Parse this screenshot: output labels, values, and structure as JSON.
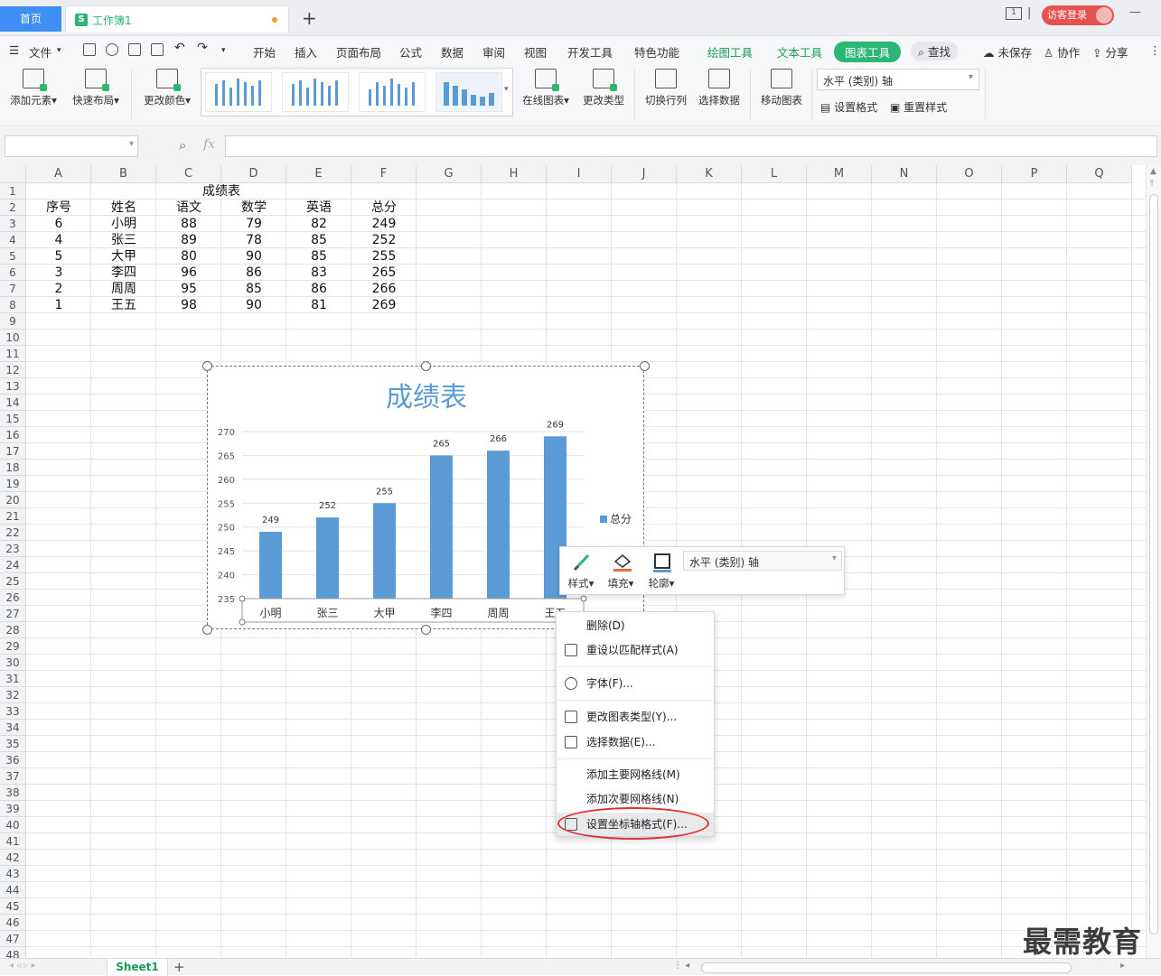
{
  "tabs": {
    "home": "首页",
    "workbook": "工作簿1",
    "new": "+"
  },
  "login": "访客登录",
  "menu": {
    "file": "文件",
    "items": [
      "开始",
      "插入",
      "页面布局",
      "公式",
      "数据",
      "审阅",
      "视图",
      "开发工具",
      "特色功能"
    ],
    "tools": [
      "绘图工具",
      "文本工具"
    ],
    "active": "图表工具",
    "search": "查找",
    "unsaved": "未保存",
    "collab": "协作",
    "share": "分享"
  },
  "ribbon": {
    "add_element": "添加元素",
    "quick_layout": "快速布局",
    "change_color": "更改颜色",
    "online_chart": "在线图表",
    "change_type": "更改类型",
    "switch_row_col": "切换行列",
    "select_data": "选择数据",
    "move_chart": "移动图表",
    "axis_select": "水平 (类别) 轴",
    "set_format": "设置格式",
    "reset_style": "重置样式"
  },
  "formula": {
    "fx": "fx",
    "namebox": "",
    "value": ""
  },
  "columns": [
    "A",
    "B",
    "C",
    "D",
    "E",
    "F",
    "G",
    "H",
    "I",
    "J",
    "K",
    "L",
    "M",
    "N",
    "O",
    "P",
    "Q"
  ],
  "rows": [
    "1",
    "2",
    "3",
    "4",
    "5",
    "6",
    "7",
    "8",
    "9",
    "10",
    "11",
    "12",
    "13",
    "14",
    "15",
    "16",
    "17",
    "18",
    "19",
    "20",
    "21",
    "22",
    "23",
    "24",
    "25",
    "26",
    "27",
    "28",
    "29",
    "30",
    "31",
    "32",
    "33",
    "34",
    "35",
    "36",
    "37",
    "38",
    "39",
    "40",
    "41",
    "42",
    "43",
    "44",
    "45",
    "46",
    "47",
    "48"
  ],
  "sheet": {
    "title": "成绩表",
    "headers": [
      "序号",
      "姓名",
      "语文",
      "数学",
      "英语",
      "总分"
    ],
    "data": [
      [
        "6",
        "小明",
        "88",
        "79",
        "82",
        "249"
      ],
      [
        "4",
        "张三",
        "89",
        "78",
        "85",
        "252"
      ],
      [
        "5",
        "大甲",
        "80",
        "90",
        "85",
        "255"
      ],
      [
        "3",
        "李四",
        "96",
        "86",
        "83",
        "265"
      ],
      [
        "2",
        "周周",
        "95",
        "85",
        "86",
        "266"
      ],
      [
        "1",
        "王五",
        "98",
        "90",
        "81",
        "269"
      ]
    ]
  },
  "chart_data": {
    "type": "bar",
    "title": "成绩表",
    "categories": [
      "小明",
      "张三",
      "大甲",
      "李四",
      "周周",
      "王五"
    ],
    "series": [
      {
        "name": "总分",
        "values": [
          249,
          252,
          255,
          265,
          266,
          269
        ],
        "color": "#5b9bd5"
      }
    ],
    "ylim": [
      235,
      270
    ],
    "yticks": [
      "235",
      "240",
      "245",
      "250",
      "255",
      "260",
      "265",
      "270"
    ],
    "data_labels": true,
    "legend": "right",
    "grid": true
  },
  "float_toolbar": {
    "style": "样式",
    "fill": "填充",
    "outline": "轮廓",
    "axis": "水平 (类别) 轴"
  },
  "context_menu": {
    "delete": "删除(D)",
    "reset_match": "重设以匹配样式(A)",
    "font": "字体(F)...",
    "change_chart_type": "更改图表类型(Y)...",
    "select_data": "选择数据(E)...",
    "add_major_grid": "添加主要网格线(M)",
    "add_minor_grid": "添加次要网格线(N)",
    "format_axis": "设置坐标轴格式(F)..."
  },
  "sheet_tab": "Sheet1",
  "watermark": "最需教育"
}
